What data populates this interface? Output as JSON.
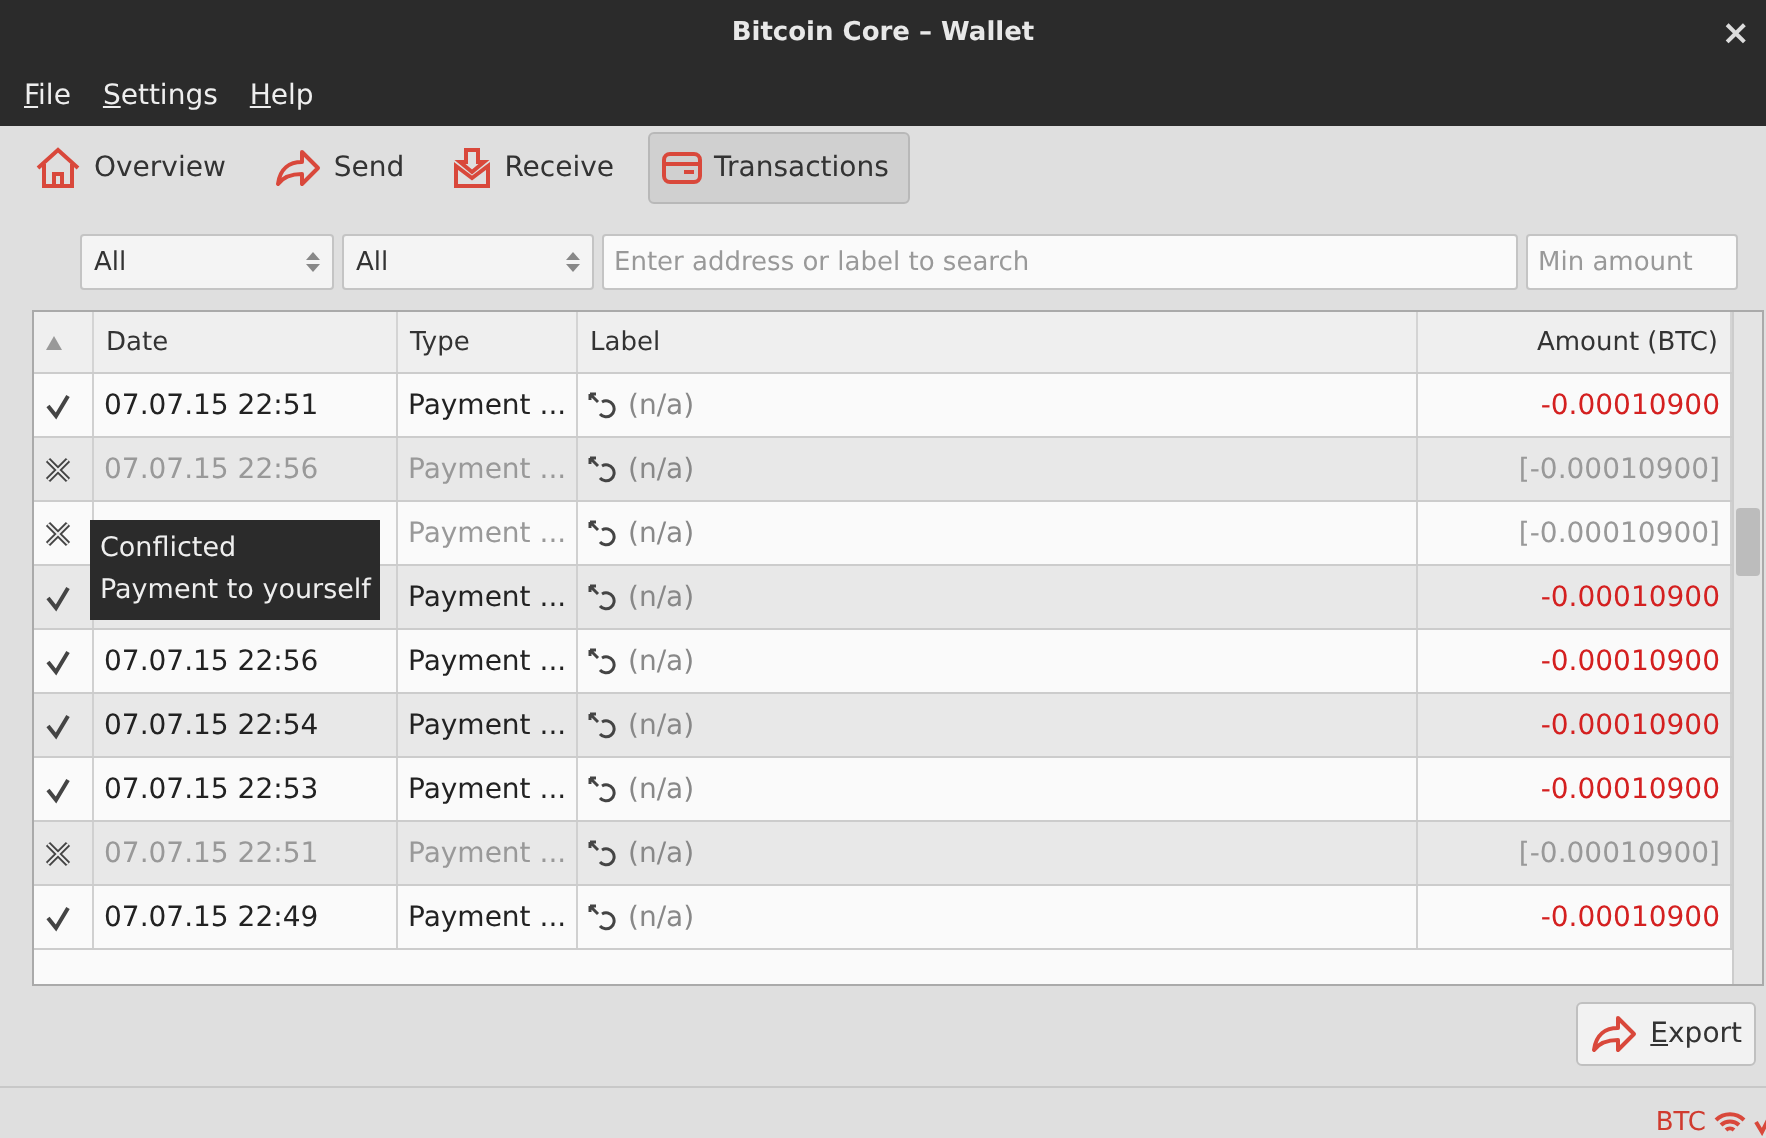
{
  "window": {
    "title": "Bitcoin Core – Wallet",
    "close": "×"
  },
  "menu": [
    "File",
    "Settings",
    "Help"
  ],
  "toolbar": [
    {
      "label": "Overview",
      "kind": "home",
      "selected": false
    },
    {
      "label": "Send",
      "kind": "send",
      "selected": false
    },
    {
      "label": "Receive",
      "kind": "receive",
      "selected": false
    },
    {
      "label": "Transactions",
      "kind": "transactions",
      "selected": true
    }
  ],
  "filters": {
    "date": "All",
    "type": "All",
    "search": {
      "placeholder": "Enter address or label to search"
    },
    "min_amount": {
      "placeholder": "Min amount"
    }
  },
  "table": {
    "columns": [
      "Date",
      "Type",
      "Label",
      "Amount (BTC)"
    ],
    "rows": [
      {
        "conflicted": false,
        "date": "07.07.15 22:51",
        "type": "Payment ...",
        "label": "(n/a)",
        "amount": "-0.00010900"
      },
      {
        "conflicted": true,
        "date": "07.07.15 22:56",
        "type": "Payment ...",
        "label": "(n/a)",
        "amount": "[-0.00010900]"
      },
      {
        "conflicted": true,
        "type": "Payment ...",
        "label": "(n/a)",
        "amount": "[-0.00010900]"
      },
      {
        "conflicted": false,
        "type": "Payment ...",
        "label": "(n/a)",
        "amount": "-0.00010900"
      },
      {
        "conflicted": false,
        "date": "07.07.15 22:56",
        "type": "Payment ...",
        "label": "(n/a)",
        "amount": "-0.00010900"
      },
      {
        "conflicted": false,
        "date": "07.07.15 22:54",
        "type": "Payment ...",
        "label": "(n/a)",
        "amount": "-0.00010900"
      },
      {
        "conflicted": false,
        "date": "07.07.15 22:53",
        "type": "Payment ...",
        "label": "(n/a)",
        "amount": "-0.00010900"
      },
      {
        "conflicted": true,
        "date": "07.07.15 22:51",
        "type": "Payment ...",
        "label": "(n/a)",
        "amount": "[-0.00010900]"
      },
      {
        "conflicted": false,
        "date": "07.07.15 22:49",
        "type": "Payment ...",
        "label": "(n/a)",
        "amount": "-0.00010900"
      }
    ]
  },
  "tooltip": [
    "Conflicted",
    "Payment to yourself"
  ],
  "export_button": "Export",
  "status_bar": {
    "unit": "BTC"
  }
}
